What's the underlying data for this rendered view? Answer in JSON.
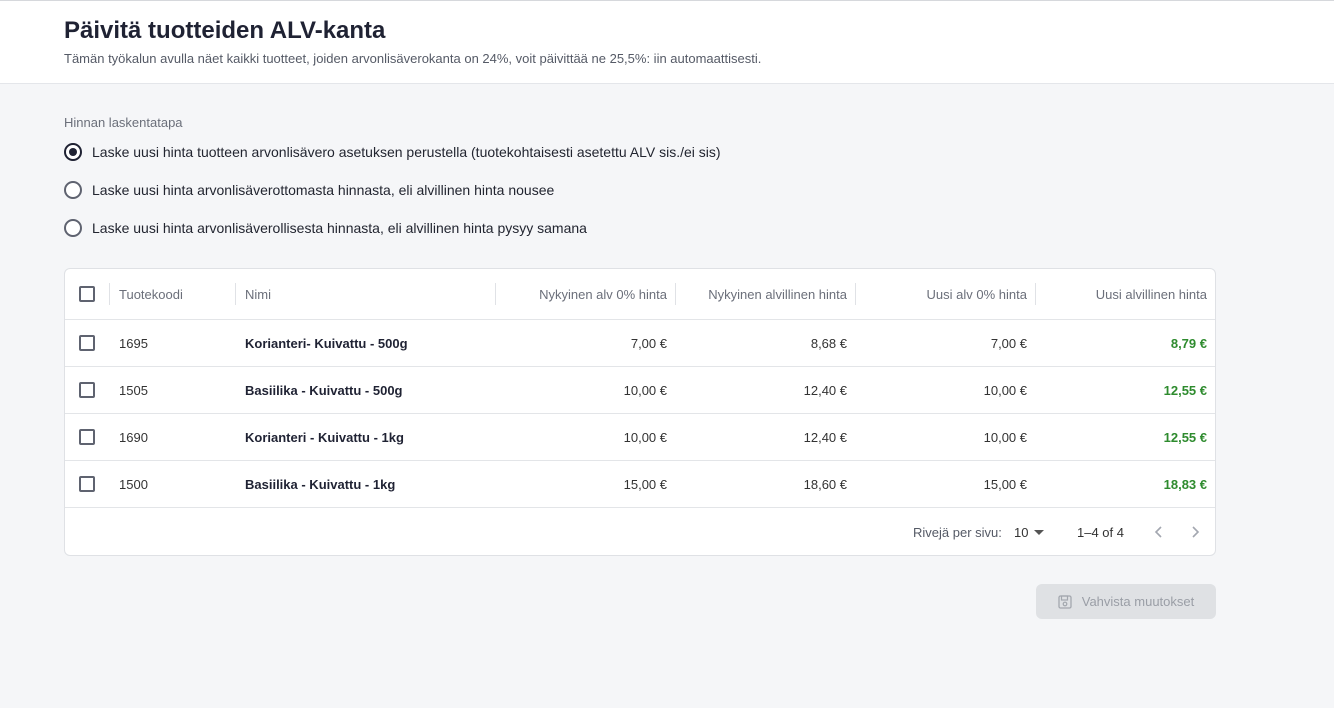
{
  "header": {
    "title": "Päivitä tuotteiden ALV-kanta",
    "subtitle": "Tämän työkalun avulla näet kaikki tuotteet, joiden arvonlisäverokanta on 24%, voit päivittää ne 25,5%: iin automaattisesti."
  },
  "pricing": {
    "label": "Hinnan laskentatapa",
    "options": [
      {
        "label": "Laske uusi hinta tuotteen arvonlisävero asetuksen perustella (tuotekohtaisesti asetettu ALV sis./ei sis)",
        "checked": true
      },
      {
        "label": "Laske uusi hinta arvonlisäverottomasta hinnasta, eli alvillinen hinta nousee",
        "checked": false
      },
      {
        "label": "Laske uusi hinta arvonlisäverollisesta hinnasta, eli alvillinen hinta pysyy samana",
        "checked": false
      }
    ]
  },
  "table": {
    "columns": {
      "code": "Tuotekoodi",
      "name": "Nimi",
      "current_net": "Nykyinen alv 0% hinta",
      "current_gross": "Nykyinen alvillinen hinta",
      "new_net": "Uusi alv 0% hinta",
      "new_gross": "Uusi alvillinen hinta"
    },
    "rows": [
      {
        "code": "1695",
        "name": "Korianteri- Kuivattu - 500g",
        "current_net": "7,00 €",
        "current_gross": "8,68 €",
        "new_net": "7,00 €",
        "new_gross": "8,79 €"
      },
      {
        "code": "1505",
        "name": "Basiilika - Kuivattu - 500g",
        "current_net": "10,00 €",
        "current_gross": "12,40 €",
        "new_net": "10,00 €",
        "new_gross": "12,55 €"
      },
      {
        "code": "1690",
        "name": "Korianteri - Kuivattu - 1kg",
        "current_net": "10,00 €",
        "current_gross": "12,40 €",
        "new_net": "10,00 €",
        "new_gross": "12,55 €"
      },
      {
        "code": "1500",
        "name": "Basiilika - Kuivattu - 1kg",
        "current_net": "15,00 €",
        "current_gross": "18,60 €",
        "new_net": "15,00 €",
        "new_gross": "18,83 €"
      }
    ],
    "footer": {
      "rows_per_page_label": "Rivejä per sivu:",
      "rows_per_page_value": "10",
      "range": "1–4 of 4"
    }
  },
  "actions": {
    "confirm_label": "Vahvista muutokset"
  },
  "colors": {
    "new_price": "#2e8b2e",
    "disabled_button": "#dfe1e4"
  }
}
